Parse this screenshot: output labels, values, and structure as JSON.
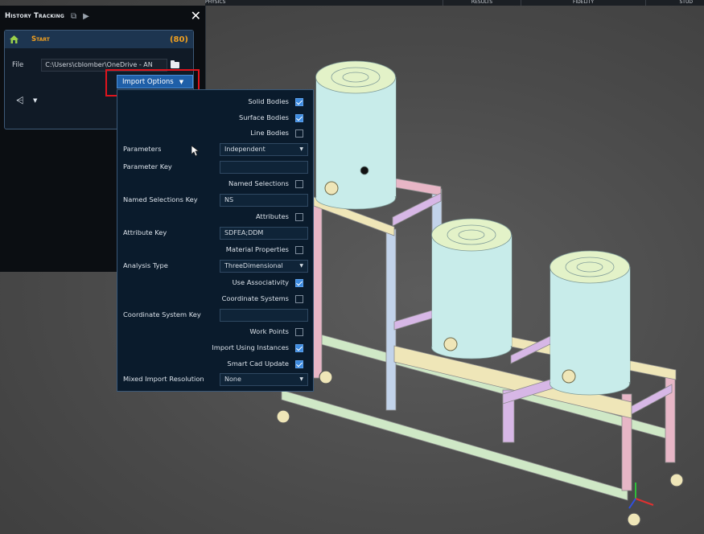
{
  "top_tabs": [
    "Physics",
    "Results",
    "Fidelity",
    "Stud"
  ],
  "history": {
    "title": "History Tracking",
    "close_label": "✕",
    "start": {
      "title": "Start",
      "count": "(80)",
      "file_label": "File",
      "file_path": "C:\\Users\\cblomber\\OneDrive - AN",
      "import_button": "Import Options"
    }
  },
  "options": {
    "solid_bodies": {
      "label": "Solid Bodies",
      "checked": true
    },
    "surface_bodies": {
      "label": "Surface Bodies",
      "checked": true
    },
    "line_bodies": {
      "label": "Line Bodies",
      "checked": false
    },
    "parameters": {
      "label": "Parameters",
      "value": "Independent"
    },
    "parameter_key": {
      "label": "Parameter Key",
      "value": ""
    },
    "named_selections": {
      "label": "Named Selections",
      "checked": false
    },
    "named_selections_key": {
      "label": "Named Selections Key",
      "value": "NS"
    },
    "attributes": {
      "label": "Attributes",
      "checked": false
    },
    "attribute_key": {
      "label": "Attribute Key",
      "value": "SDFEA;DDM"
    },
    "material_properties": {
      "label": "Material Properties",
      "checked": false
    },
    "analysis_type": {
      "label": "Analysis Type",
      "value": "ThreeDimensional"
    },
    "use_associativity": {
      "label": "Use Associativity",
      "checked": true
    },
    "coordinate_systems": {
      "label": "Coordinate Systems",
      "checked": false
    },
    "coordinate_system_key": {
      "label": "Coordinate System Key",
      "value": ""
    },
    "work_points": {
      "label": "Work Points",
      "checked": false
    },
    "import_using_instances": {
      "label": "Import Using Instances",
      "checked": true
    },
    "smart_cad_update": {
      "label": "Smart Cad Update",
      "checked": true
    },
    "mixed_import_resolution": {
      "label": "Mixed Import Resolution",
      "value": "None"
    }
  },
  "colors": {
    "accent": "#1f5fa8",
    "start_orange": "#f0a020",
    "highlight_red": "#e0141d",
    "tank": "#c8ecea",
    "frame_pink": "#e7b6c6",
    "frame_green": "#cfe8c6",
    "frame_yellow": "#efe6b8",
    "frame_purple": "#d7b7e6",
    "frame_blue": "#c2d3ea"
  }
}
